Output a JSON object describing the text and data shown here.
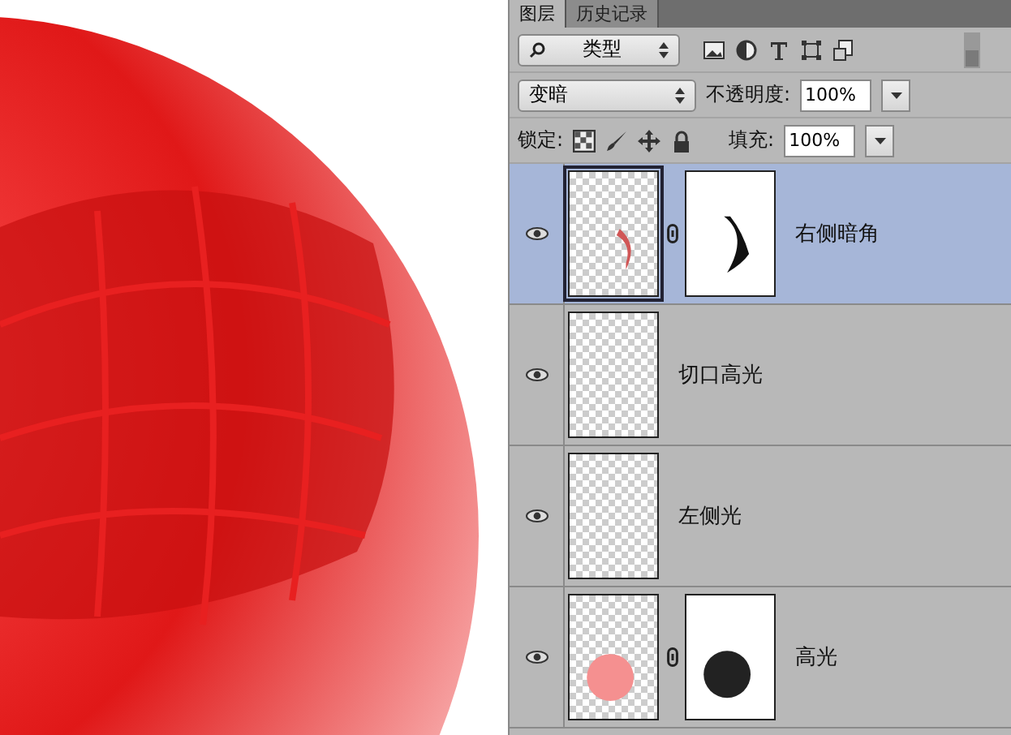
{
  "tabs": [
    {
      "label": "图层",
      "selected": true
    },
    {
      "label": "历史记录",
      "selected": false
    }
  ],
  "filter": {
    "value": "类型"
  },
  "blend": {
    "value": "变暗",
    "opacity_label": "不透明度:",
    "opacity": "100%"
  },
  "lock": {
    "label": "锁定:",
    "fill_label": "填充:",
    "fill": "100%"
  },
  "layers": [
    {
      "name": "右侧暗角",
      "selected": true,
      "visible": true,
      "kind": "stroke",
      "mask": true
    },
    {
      "name": "切口高光",
      "selected": false,
      "visible": true,
      "kind": "empty"
    },
    {
      "name": "左侧光",
      "selected": false,
      "visible": true,
      "kind": "empty"
    },
    {
      "name": "高光",
      "selected": false,
      "visible": true,
      "kind": "circle",
      "mask": true
    }
  ]
}
